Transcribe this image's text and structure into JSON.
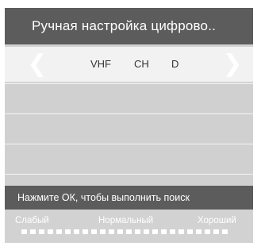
{
  "title": "Ручная настройка цифрово..",
  "selector": {
    "left_icon": "chevron-left-icon",
    "right_icon": "chevron-right-icon",
    "band": "VHF",
    "ch_label": "CH",
    "channel": "D"
  },
  "hint": "Нажмите ОК, чтобы выполнить поиск",
  "signal": {
    "weak_label": "Слабый",
    "normal_label": "Нормальный",
    "good_label": "Хороший",
    "segment_count": 24
  },
  "colors": {
    "bar_dark": "#5c5c5c",
    "panel": "#d2d2d2",
    "selected_row": "#f2f2f2"
  }
}
